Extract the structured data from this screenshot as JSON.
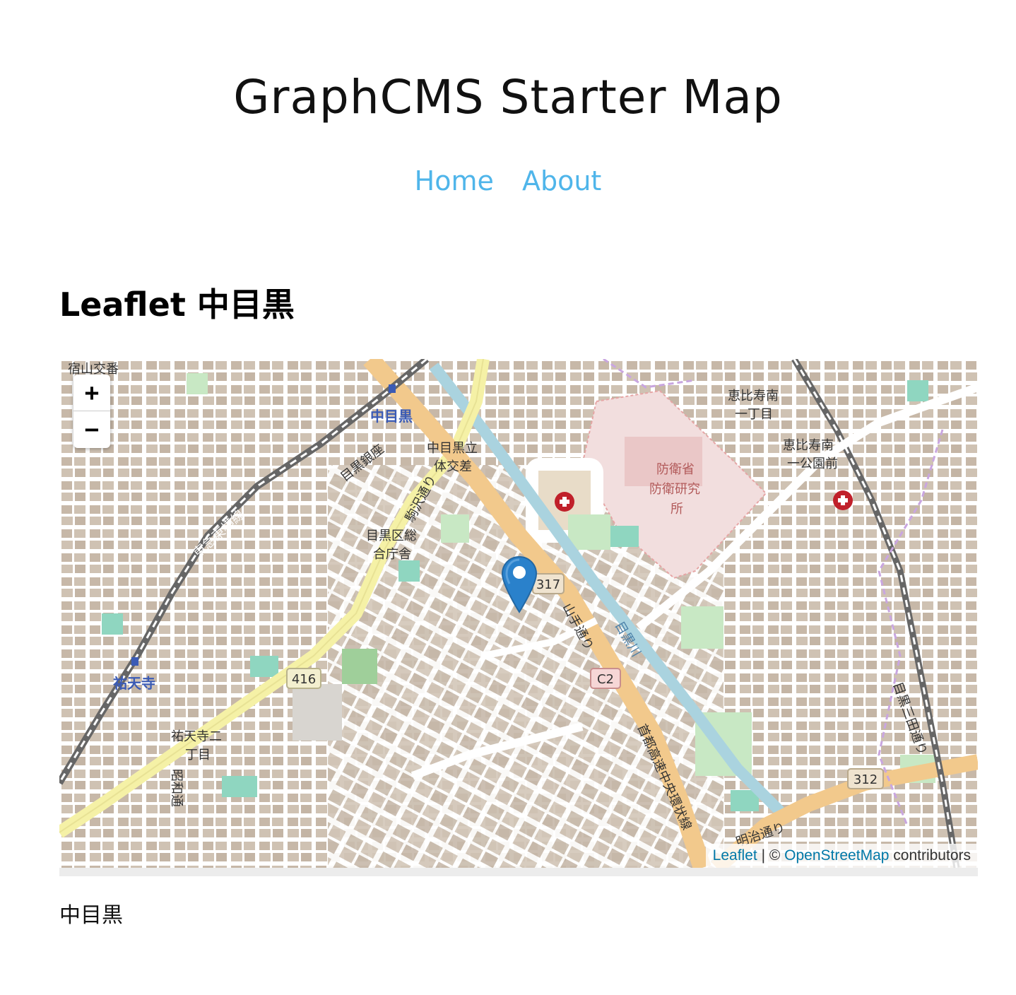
{
  "site": {
    "title": "GraphCMS Starter Map"
  },
  "nav": {
    "items": [
      {
        "label": "Home"
      },
      {
        "label": "About"
      }
    ]
  },
  "section": {
    "title": "Leaflet 中目黒",
    "caption": "中目黒"
  },
  "map": {
    "zoom_in_label": "+",
    "zoom_out_label": "−",
    "attribution": {
      "leaflet_link": "Leaflet",
      "separator": " | © ",
      "osm_link": "OpenStreetMap",
      "suffix": " contributors"
    },
    "labels": {
      "nakameguro_station": "中目黒",
      "yutenji_station": "祐天寺",
      "defense_ministry": "防衛省",
      "defense_research": "防衛研究",
      "defense_tokoro": "所",
      "meguro_office_1": "目黒区総",
      "meguro_office_2": "合庁舎",
      "route_317": "317",
      "route_416": "416",
      "route_c2": "C2",
      "route_312": "312",
      "yamate_dori": "山手通り",
      "meguro_river": "目黒川",
      "komazawa_dori": "駒沢通り",
      "toyoko_line": "東急東横線",
      "shuto_expressway": "首都高速中央環状線",
      "ebisu_minami": "恵比寿南",
      "itchome": "一丁目",
      "ebisu_park_1": "恵比寿南",
      "ebisu_park_2": "一公園前",
      "nakameguro_tai_1": "中目黒立",
      "nakameguro_tai_2": "体交差",
      "yutenji_2_1": "祐天寺二",
      "yutenji_2_2": "丁目",
      "showa_dori": "昭和通",
      "meguro_ginza": "目黒銀座",
      "sukiyama": "宿山交番",
      "meguro_mita": "目黒三田通り",
      "meiji_dori": "明治通り"
    },
    "colors": {
      "land": "#e7e1d9",
      "building": "#c9bcad",
      "road": "#ffffff",
      "major_road": "#f2c98c",
      "secondary_road": "#f5f1a6",
      "river": "#aad3df",
      "park": "#c8e8c4",
      "defense_area": "#f2dede",
      "rail": "#555555",
      "marker": "#2a81cb"
    }
  }
}
